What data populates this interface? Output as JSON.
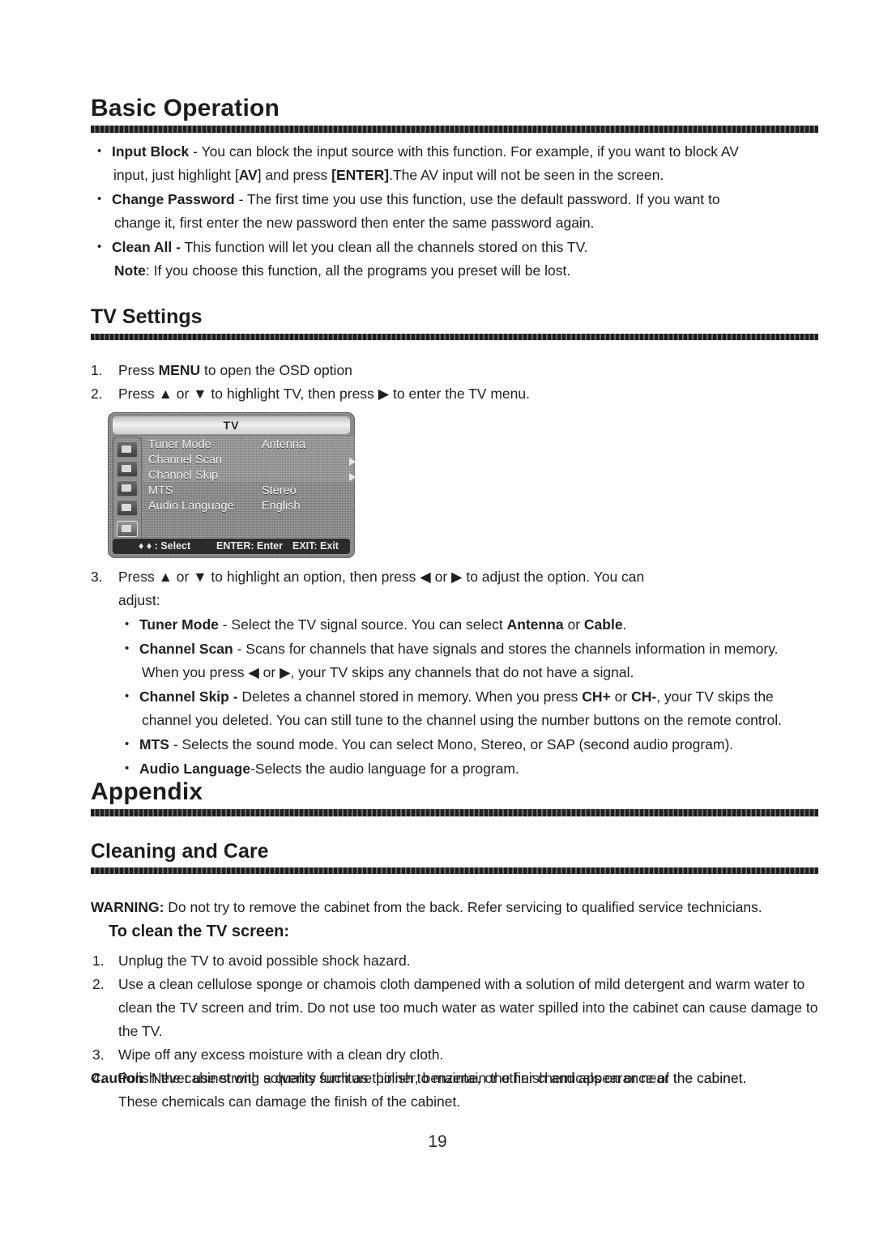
{
  "page": {
    "number": "19"
  },
  "section_basic": {
    "heading": "Basic Operation",
    "bullets": [
      {
        "term": "Input Block",
        "line1_a": " - You can block the input source with this function. For example, if you want to block AV",
        "line2_a": "input, just highlight [",
        "line2_b": "AV",
        "line2_c": "] and press ",
        "line2_d": "[ENTER]",
        "line2_e": ".The AV input will not be seen in the screen."
      },
      {
        "term": "Change Password",
        "line1_a": " - The first time you use this function, use the default password. If you want to",
        "line2_a": "change it, first  enter the new password then enter the same password again."
      },
      {
        "term": "Clean All -",
        "line1_a": " This function will let you clean all the channels stored on this TV.",
        "note_term": "Note",
        "note_text": ": If you choose this function, all the programs you preset will be lost."
      }
    ]
  },
  "section_tv_settings": {
    "heading": "TV Settings",
    "steps": [
      {
        "num": "1.",
        "a": "Press ",
        "b": "MENU",
        "c": " to open the OSD option"
      },
      {
        "num": "2.",
        "a": "Press ",
        "up": "▲",
        "or1": " or ",
        "down": "▼",
        "c": " to highlight TV, then press ",
        "right": "▶",
        "d": " to enter the TV menu."
      },
      {
        "num": "3.",
        "a": "Press ",
        "up": "▲",
        "or1": " or ",
        "down": "▼",
        "c": " to highlight an option, then press ",
        "left": "◀",
        "or2": " or ",
        "right": "▶",
        "d": " to adjust the option. You can",
        "line2": "adjust:"
      }
    ],
    "osd": {
      "title": "TV",
      "rows": [
        {
          "label": "Tuner Mode",
          "value": "Antenna",
          "arrow": false
        },
        {
          "label": "Channel Scan",
          "value": "",
          "arrow": true
        },
        {
          "label": "Channel Skip",
          "value": "",
          "arrow": true
        },
        {
          "label": "MTS",
          "value": "Stereo",
          "arrow": false
        },
        {
          "label": "Audio Language",
          "value": "English",
          "arrow": false
        }
      ],
      "footer": {
        "select": "♦ ♦ :  Select",
        "enter": "ENTER: Enter",
        "exit": "EXIT: Exit"
      },
      "icons": [
        "picture-icon",
        "sound-icon",
        "setup-icon",
        "lock-icon",
        "tv-icon"
      ]
    },
    "options": [
      {
        "term": "Tuner Mode",
        "a": " - Select the TV signal source. You can select ",
        "b1": "Antenna",
        "mid": " or ",
        "b2": "Cable",
        "c": "."
      },
      {
        "term": "Channel Scan",
        "a": " - Scans for channels that have signals and stores the channels information in memory.",
        "l2_a": "When you press ",
        "left": "◀",
        "l2_b": " or ",
        "right": "▶",
        "l2_c": ", your TV skips any channels that do not have a signal."
      },
      {
        "term": "Channel Skip -",
        "a": " Deletes a channel stored in memory. When you  press ",
        "b1": "CH+",
        "mid": " or ",
        "b2": "CH-",
        "c": ", your TV skips the",
        "l2": "channel you deleted. You can still tune to the channel using the number buttons on the remote control."
      },
      {
        "term": "MTS",
        "a": " - Selects the sound mode. You can select Mono, Stereo, or SAP (second audio program)."
      },
      {
        "term": "Audio Language",
        "a": "-Selects the audio language for a program."
      }
    ]
  },
  "section_appendix": {
    "heading": "Appendix"
  },
  "section_cleaning": {
    "heading": "Cleaning and Care",
    "warning_term": "WARNING:",
    "warning_text": " Do not try to remove the cabinet from the back. Refer servicing to qualified service technicians.",
    "subheading": "To clean  the TV screen:",
    "steps": [
      {
        "num": "1.",
        "text": "Unplug the TV to avoid possible shock hazard."
      },
      {
        "num": "2.",
        "text": "Use a clean cellulose sponge or chamois cloth dampened with a solution of mild detergent and warm water to clean the TV screen and trim. Do not use too much water as water spilled into  the cabinet   can cause damage to the TV."
      },
      {
        "num": "3.",
        "text": "Wipe off any excess moisture with a clean dry cloth."
      },
      {
        "num": "4.",
        "text": "Polish the cabinet with a quality furniture polish to maintain the finish and appearance of the cabinet."
      }
    ],
    "caution_term": "Caution",
    "caution_text": ": Never use strong solvents such as thinner, benzene, or other chemicals on or near the cabinet.",
    "caution_line2": "These chemicals can damage the finish of the cabinet."
  }
}
